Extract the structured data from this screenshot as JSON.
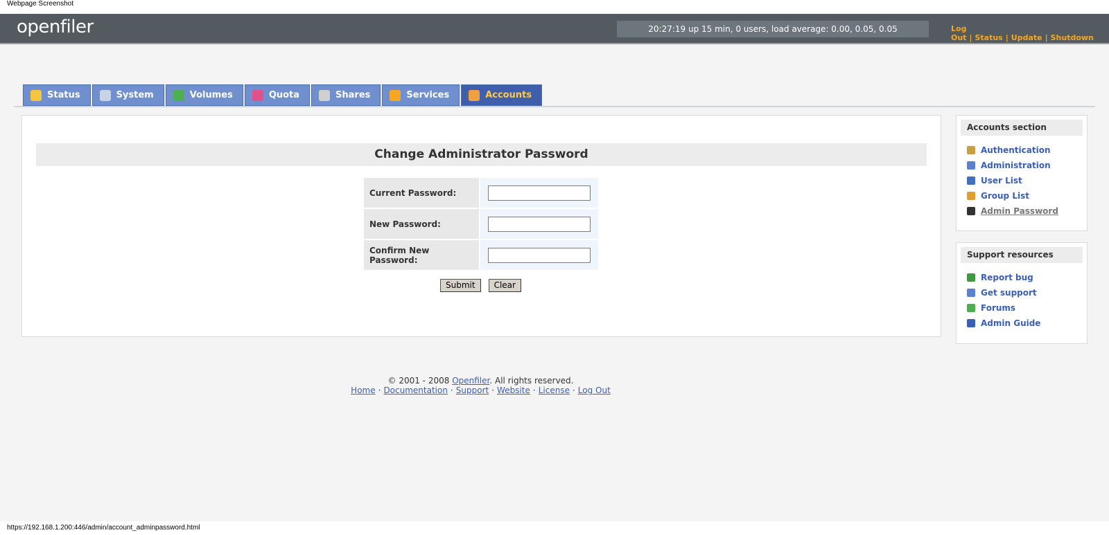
{
  "caption": "Webpage Screenshot",
  "header": {
    "logo": "openfiler",
    "uptime": "20:27:19 up 15 min, 0 users, load average: 0.00, 0.05, 0.05",
    "links": [
      "Log Out",
      "Status",
      "Update",
      "Shutdown"
    ]
  },
  "tabs": [
    {
      "label": "Status",
      "icon": "sun-cloud-icon",
      "color": "#f5c542"
    },
    {
      "label": "System",
      "icon": "computer-icon",
      "color": "#c9d3e6"
    },
    {
      "label": "Volumes",
      "icon": "disk-icon",
      "color": "#4caf50"
    },
    {
      "label": "Quota",
      "icon": "pie-icon",
      "color": "#e0508a"
    },
    {
      "label": "Shares",
      "icon": "server-icon",
      "color": "#d0d0d0"
    },
    {
      "label": "Services",
      "icon": "lightning-icon",
      "color": "#f5a623"
    },
    {
      "label": "Accounts",
      "icon": "user-icon",
      "color": "#f0a040"
    }
  ],
  "main": {
    "title": "Change Administrator Password",
    "fields": [
      {
        "label": "Current Password:",
        "value": ""
      },
      {
        "label": "New Password:",
        "value": ""
      },
      {
        "label": "Confirm New Password:",
        "value": ""
      }
    ],
    "submit_label": "Submit",
    "clear_label": "Clear"
  },
  "sidebar": {
    "accounts_title": "Accounts section",
    "accounts_items": [
      {
        "label": "Authentication",
        "icon": "lock-user-icon",
        "color": "#c8a040"
      },
      {
        "label": "Administration",
        "icon": "admin-user-icon",
        "color": "#5a80d0"
      },
      {
        "label": "User List",
        "icon": "user-icon",
        "color": "#4070c0"
      },
      {
        "label": "Group List",
        "icon": "group-icon",
        "color": "#e0a030"
      },
      {
        "label": "Admin Password",
        "icon": "penguin-icon",
        "color": "#333333"
      }
    ],
    "support_title": "Support resources",
    "support_items": [
      {
        "label": "Report bug",
        "icon": "bug-icon",
        "color": "#3f9a3f"
      },
      {
        "label": "Get support",
        "icon": "support-icon",
        "color": "#5a80d0"
      },
      {
        "label": "Forums",
        "icon": "forums-icon",
        "color": "#4caf50"
      },
      {
        "label": "Admin Guide",
        "icon": "book-icon",
        "color": "#3a5fb6"
      }
    ]
  },
  "footer": {
    "copyright_prefix": "© 2001 - 2008 ",
    "copyright_link": "Openfiler",
    "copyright_suffix": ". All rights reserved.",
    "links": [
      "Home",
      "Documentation",
      "Support",
      "Website",
      "License",
      "Log Out"
    ]
  },
  "status_url": "https://192.168.1.200:446/admin/account_adminpassword.html"
}
